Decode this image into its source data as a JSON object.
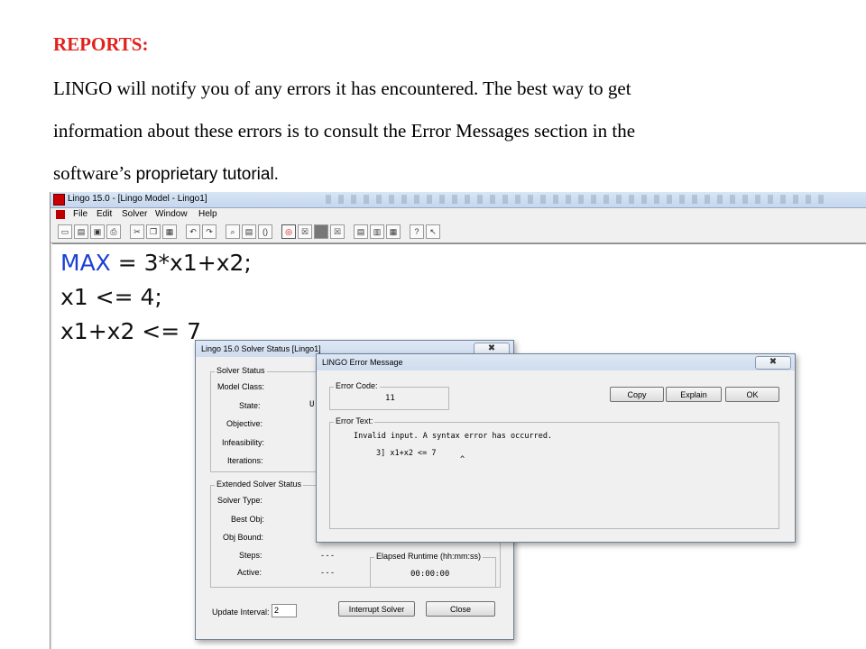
{
  "doc": {
    "heading": "REPORTS:",
    "line1": "LINGO will notify you of any errors it has encountered. The best way to get",
    "line2": "information about these errors is to consult the Error Messages section in the",
    "line3_a": "software’s ",
    "line3_b": "proprietary tutorial."
  },
  "app": {
    "title": "Lingo 15.0 - [Lingo Model - Lingo1]",
    "menus": [
      "File",
      "Edit",
      "Solver",
      "Window",
      "Help"
    ]
  },
  "model": {
    "line1_kw": "MAX",
    "line1_rest": " = 3*x1+x2;",
    "line2": "x1 <= 4;",
    "line3": "x1+x2 <= 7"
  },
  "solver_status": {
    "title": "Lingo 15.0 Solver Status [Lingo1]",
    "close": "✖",
    "group_solver": "Solver Status",
    "model_class": "Model Class:",
    "state": "State:",
    "state_value": "U",
    "objective": "Objective:",
    "infeasibility": "Infeasibility:",
    "iterations": "Iterations:",
    "group_extended": "Extended Solver Status",
    "solver_type": "Solver Type:",
    "best_obj": "Best Obj:",
    "obj_bound": "Obj Bound:",
    "steps": "Steps:",
    "steps_value": "-   -   -",
    "active": "Active:",
    "active_value": "-   -   -",
    "elapsed_label": "Elapsed Runtime (hh:mm:ss)",
    "elapsed_value": "00:00:00",
    "update_interval": "Update Interval:",
    "update_value": "2",
    "interrupt_button": "Interrupt Solver",
    "close_button": "Close"
  },
  "error_dialog": {
    "title": "LINGO Error Message",
    "close": "✖",
    "code_label": "Error Code:",
    "code_value": "11",
    "copy": "Copy",
    "explain": "Explain",
    "ok": "OK",
    "text_label": "Error Text:",
    "text_line1": "Invalid input.  A syntax error has occurred.",
    "text_line2": "3]  x1+x2 <= 7",
    "text_line3": "^"
  }
}
